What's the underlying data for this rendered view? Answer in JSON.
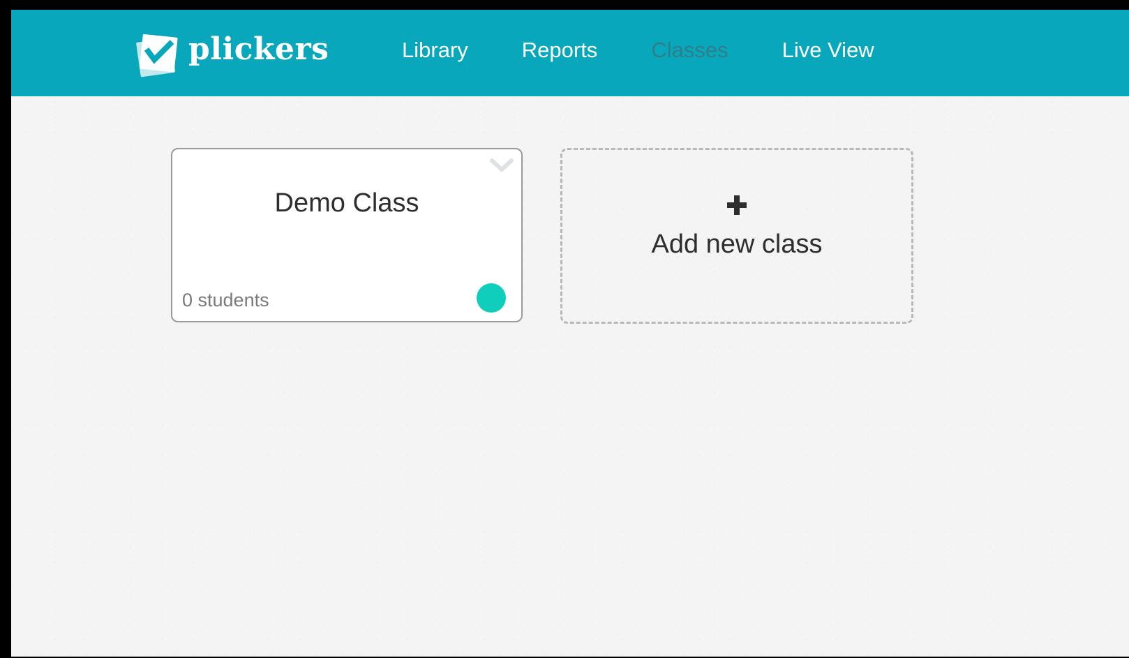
{
  "app": {
    "logo_text": "plickers",
    "logo_icon": "checkmark-cards-icon",
    "brand_color": "#09a7bb"
  },
  "nav": {
    "items": [
      {
        "label": "Library",
        "active": false
      },
      {
        "label": "Reports",
        "active": false
      },
      {
        "label": "Classes",
        "active": true
      },
      {
        "label": "Live View",
        "active": false
      }
    ]
  },
  "classes": [
    {
      "name": "Demo Class",
      "student_count_text": "0 students",
      "color": "#0fcfbc",
      "menu_icon": "chevron-down-icon"
    }
  ],
  "add_class": {
    "label": "Add new class",
    "icon": "plus-icon"
  }
}
